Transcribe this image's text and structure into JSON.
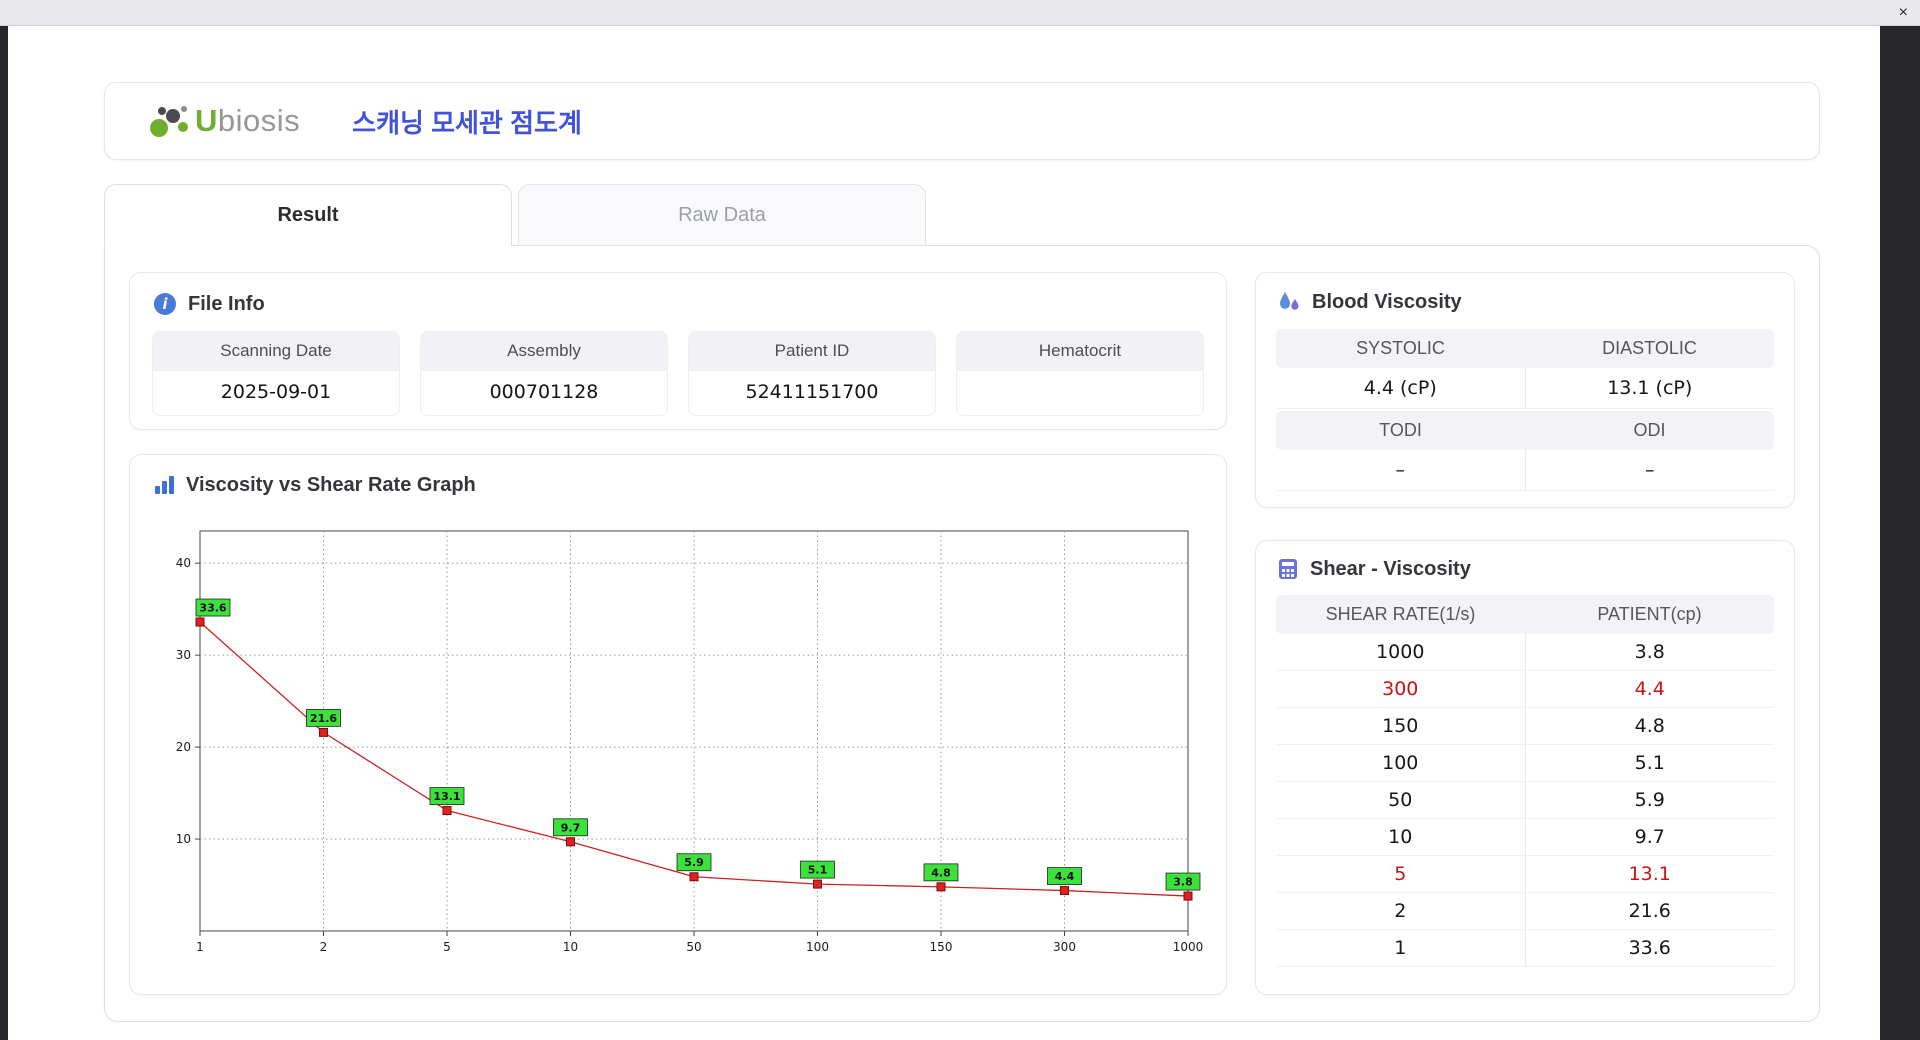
{
  "window": {
    "close_glyph": "×"
  },
  "header": {
    "logo_accent": "U",
    "logo_rest": "biosis",
    "app_title": "스캐닝 모세관 점도계"
  },
  "tabs": [
    {
      "label": "Result",
      "active": true
    },
    {
      "label": "Raw Data",
      "active": false
    }
  ],
  "file_info": {
    "title": "File Info",
    "fields": [
      {
        "label": "Scanning Date",
        "value": "2025-09-01"
      },
      {
        "label": "Assembly",
        "value": "000701128"
      },
      {
        "label": "Patient ID",
        "value": "52411151700"
      },
      {
        "label": "Hematocrit",
        "value": ""
      }
    ]
  },
  "graph": {
    "title": "Viscosity vs Shear Rate Graph"
  },
  "blood_viscosity": {
    "title": "Blood Viscosity",
    "systolic_label": "SYSTOLIC",
    "systolic_value": "4.4 (cP)",
    "diastolic_label": "DIASTOLIC",
    "diastolic_value": "13.1 (cP)",
    "todi_label": "TODI",
    "todi_value": "–",
    "odi_label": "ODI",
    "odi_value": "–"
  },
  "shear_viscosity": {
    "title": "Shear - Viscosity",
    "columns": [
      "SHEAR RATE(1/s)",
      "PATIENT(cp)"
    ],
    "rows": [
      {
        "shear": "1000",
        "patient": "3.8",
        "highlight": false
      },
      {
        "shear": "300",
        "patient": "4.4",
        "highlight": true
      },
      {
        "shear": "150",
        "patient": "4.8",
        "highlight": false
      },
      {
        "shear": "100",
        "patient": "5.1",
        "highlight": false
      },
      {
        "shear": "50",
        "patient": "5.9",
        "highlight": false
      },
      {
        "shear": "10",
        "patient": "9.7",
        "highlight": false
      },
      {
        "shear": "5",
        "patient": "13.1",
        "highlight": true
      },
      {
        "shear": "2",
        "patient": "21.6",
        "highlight": false
      },
      {
        "shear": "1",
        "patient": "33.6",
        "highlight": false
      }
    ]
  },
  "chart_data": {
    "type": "line",
    "title": "Viscosity vs Shear Rate Graph",
    "x_scale": "categorical-log-ticks",
    "x_categories": [
      "1",
      "2",
      "5",
      "10",
      "50",
      "100",
      "150",
      "300",
      "1000"
    ],
    "values": [
      33.6,
      21.6,
      13.1,
      9.7,
      5.9,
      5.1,
      4.8,
      4.4,
      3.8
    ],
    "point_labels": [
      "33.6",
      "21.6",
      "13.1",
      "9.7",
      "5.9",
      "5.1",
      "4.8",
      "4.4",
      "3.8"
    ],
    "xlabel": "",
    "ylabel": "",
    "yticks": [
      10,
      20,
      30,
      40
    ],
    "ylim": [
      0,
      43.5
    ],
    "grid": true,
    "legend": false,
    "line_color": "#cc2222",
    "marker_color": "#e02121",
    "marker_shape": "square",
    "label_bg": "#3ce13c",
    "label_border": "#222222"
  }
}
